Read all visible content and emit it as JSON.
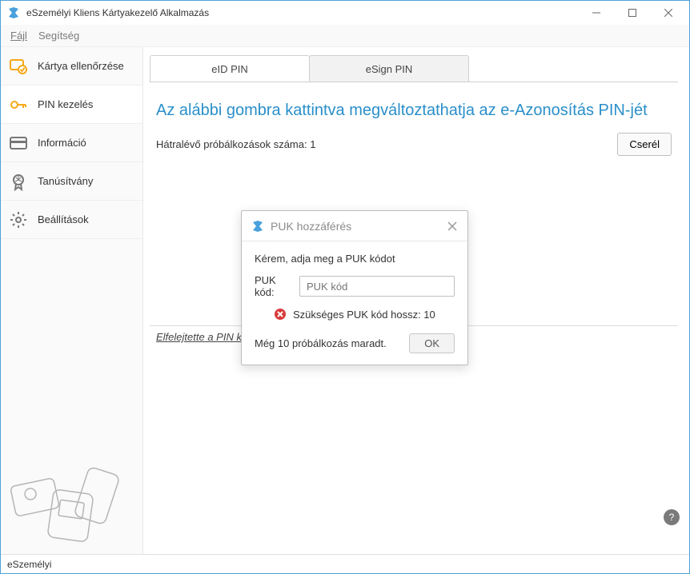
{
  "window": {
    "title": "eSzemélyi Kliens Kártyakezelő Alkalmazás"
  },
  "menu": {
    "file": "Fájl",
    "help": "Segítség"
  },
  "sidebar": {
    "items": [
      {
        "label": "Kártya ellenőrzése"
      },
      {
        "label": "PIN kezelés"
      },
      {
        "label": "Információ"
      },
      {
        "label": "Tanúsítvány"
      },
      {
        "label": "Beállítások"
      }
    ]
  },
  "tabs": [
    {
      "label": "eID PIN"
    },
    {
      "label": "eSign PIN"
    }
  ],
  "main": {
    "headline": "Az alábbi gombra kattintva megváltoztathatja az e-Azonosítás PIN-jét",
    "attempts_label": "Hátralévő próbálkozások száma: 1",
    "change_button": "Cserél",
    "forgot_link": "Elfelejtette a PIN kódot?"
  },
  "dialog": {
    "title": "PUK hozzáférés",
    "prompt": "Kérem, adja meg a PUK kódot",
    "field_label": "PUK kód:",
    "placeholder": "PUK kód",
    "error": "Szükséges PUK kód hossz: 10",
    "attempts_left": "Még 10 próbálkozás maradt.",
    "ok": "OK"
  },
  "status": {
    "text": "eSzemélyi"
  },
  "icons": {
    "help": "?"
  }
}
